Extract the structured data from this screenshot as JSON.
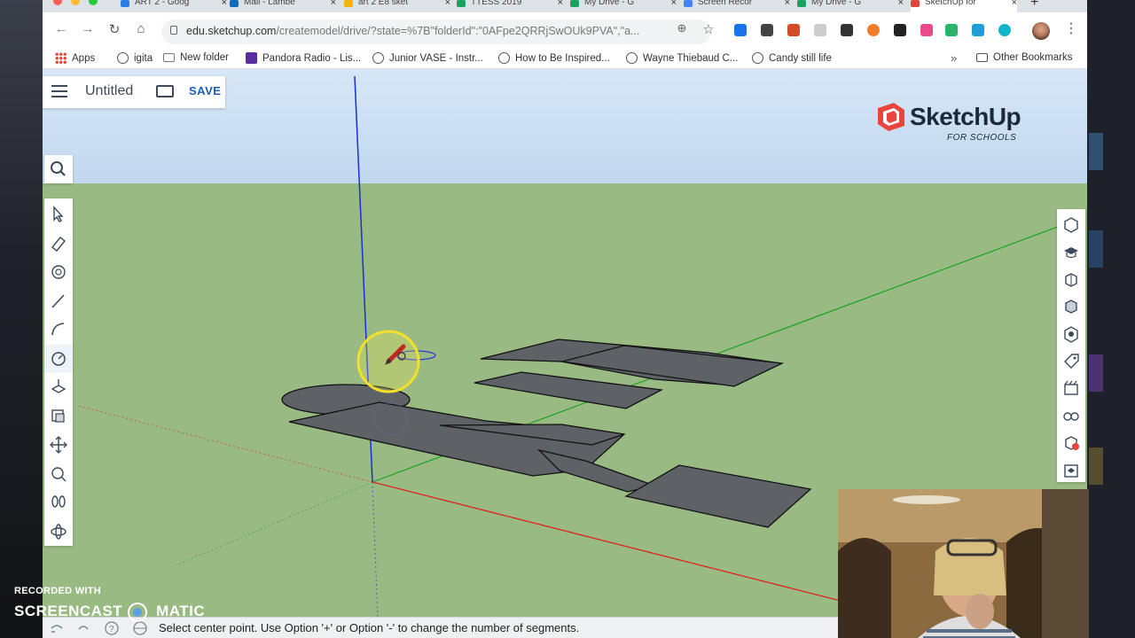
{
  "browser": {
    "tabs": [
      {
        "label": "ART 2 - Goog",
        "color": "#2a7de1",
        "active": false
      },
      {
        "label": "Mail - Lambe",
        "color": "#0f6cbd",
        "active": false
      },
      {
        "label": "art 2 E8 sket",
        "color": "#f4b400",
        "active": false
      },
      {
        "label": "TTESS 2019",
        "color": "#1aa260",
        "active": false
      },
      {
        "label": "My Drive - G",
        "color": "#1aa260",
        "active": false
      },
      {
        "label": "Screen Recor",
        "color": "#4285f4",
        "active": false
      },
      {
        "label": "My Drive - G",
        "color": "#1aa260",
        "active": false
      },
      {
        "label": "SketchUp for",
        "color": "#e2453c",
        "active": true
      }
    ],
    "url_main": "edu.sketchup.com",
    "url_rest": "/createmodel/drive/?state=%7B\"folderId\":\"0AFpe2QRRjSwOUk9PVA\",\"a...",
    "bookmarks": [
      {
        "label": "Apps",
        "icon": "apps-grid-icon"
      },
      {
        "label": "igita",
        "icon": "globe-icon"
      },
      {
        "label": "New folder",
        "icon": "folder-icon"
      },
      {
        "label": "Pandora Radio - Lis...",
        "icon": "pandora-icon"
      },
      {
        "label": "Junior VASE - Instr...",
        "icon": "globe-icon"
      },
      {
        "label": "How to Be Inspired...",
        "icon": "globe-icon"
      },
      {
        "label": "Wayne Thiebaud C...",
        "icon": "globe-icon"
      },
      {
        "label": "Candy still life",
        "icon": "globe-icon"
      }
    ],
    "overflow": "»",
    "other_bookmarks": "Other Bookmarks"
  },
  "app": {
    "doc_title": "Untitled",
    "save_label": "SAVE",
    "logo_text": "SketchUp",
    "logo_sub": "FOR SCHOOLS",
    "status_text": "Select center point. Use Option '+' or Option '-' to change the number of segments.",
    "active_tool": "circle-tool",
    "left_tools": [
      "select-tool-icon",
      "eraser-tool-icon",
      "paint-bucket-icon",
      "line-tool-icon",
      "arc-tool-icon",
      "circle-tool-icon",
      "push-pull-icon",
      "offset-icon",
      "move-tool-icon",
      "tape-measure-icon",
      "walk-icon",
      "orbit-icon"
    ],
    "right_tools": [
      "entity-info-icon",
      "instructor-icon",
      "components-icon",
      "materials-icon",
      "styles-icon",
      "tags-icon",
      "scenes-icon",
      "display-icon",
      "outliner-icon",
      "3d-warehouse-icon"
    ]
  },
  "watermark": {
    "line1": "RECORDED WITH",
    "line2a": "SCREENCAST",
    "line2b": "MATIC"
  }
}
